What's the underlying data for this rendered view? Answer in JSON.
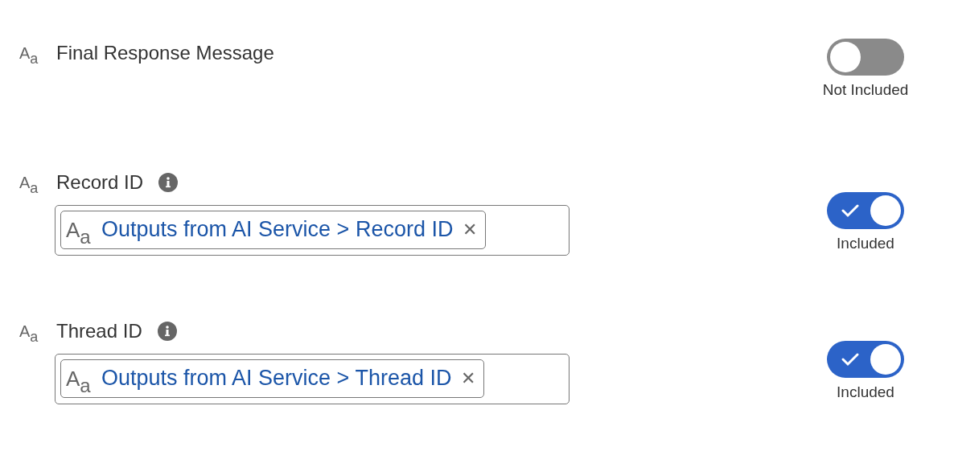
{
  "fields": [
    {
      "type_icon": "A$_{a}$",
      "label": "Final Response Message",
      "info": false,
      "included": false,
      "status": "Not Included"
    },
    {
      "type_icon": "A$_{a}$",
      "label": "Record ID",
      "info": true,
      "value": {
        "type_icon": "A$_{a}$",
        "text": "Outputs from AI Service > Record ID",
        "remove": "✕"
      },
      "included": true,
      "status": "Included"
    },
    {
      "type_icon": "A$_{a}$",
      "label": "Thread ID",
      "info": true,
      "value": {
        "type_icon": "A$_{a}$",
        "text": "Outputs from AI Service > Thread ID",
        "remove": "✕"
      },
      "included": true,
      "status": "Included"
    }
  ]
}
